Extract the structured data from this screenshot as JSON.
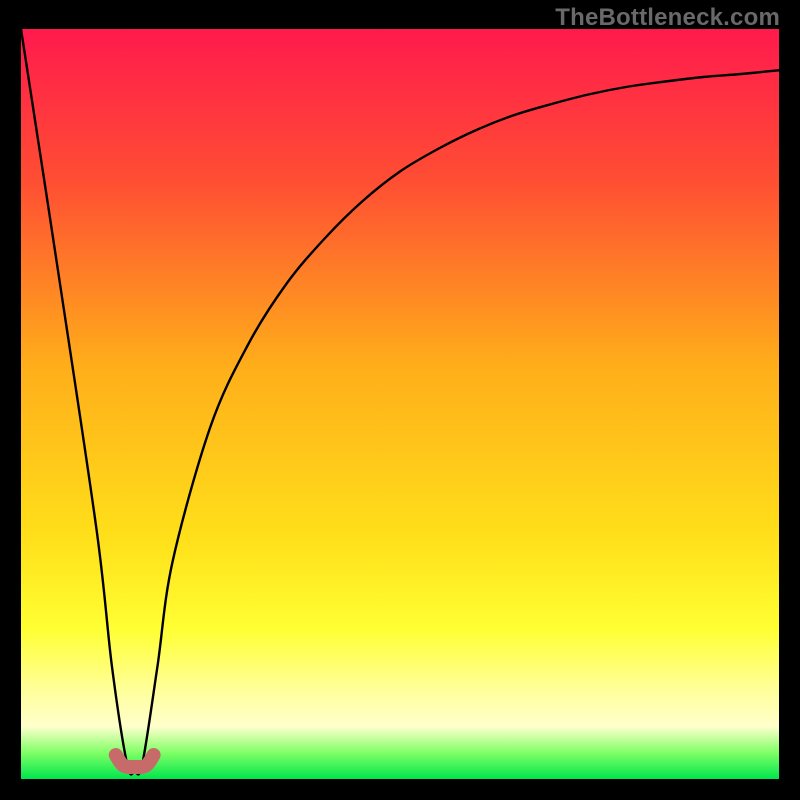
{
  "watermark": "TheBottleneck.com",
  "chart_data": {
    "type": "line",
    "title": "",
    "xlabel": "",
    "ylabel": "",
    "xlim": [
      0,
      100
    ],
    "ylim": [
      0,
      100
    ],
    "series": [
      {
        "name": "bottleneck-curve",
        "x": [
          0,
          5,
          10,
          12,
          14,
          15,
          16,
          18,
          20,
          25,
          30,
          35,
          40,
          45,
          50,
          55,
          60,
          65,
          70,
          75,
          80,
          85,
          90,
          95,
          100
        ],
        "y": [
          100,
          67,
          33,
          15,
          2,
          1,
          2,
          15,
          29,
          47,
          58,
          66,
          72,
          77,
          81,
          84,
          86.5,
          88.5,
          90,
          91.3,
          92.3,
          93,
          93.6,
          94,
          94.5
        ]
      },
      {
        "name": "sweet-spot-marker",
        "x": [
          12.5,
          13.5,
          15,
          16.5,
          17.5
        ],
        "y": [
          3.2,
          1.8,
          1.6,
          1.8,
          3.2
        ]
      }
    ],
    "gradient_stops": [
      {
        "pos": 0.0,
        "color": "#ff1a4d"
      },
      {
        "pos": 0.2,
        "color": "#ff4d33"
      },
      {
        "pos": 0.45,
        "color": "#ffae1a"
      },
      {
        "pos": 0.68,
        "color": "#ffe01a"
      },
      {
        "pos": 0.8,
        "color": "#ffff33"
      },
      {
        "pos": 0.88,
        "color": "#ffff99"
      },
      {
        "pos": 0.93,
        "color": "#ffffcc"
      },
      {
        "pos": 0.965,
        "color": "#80ff66"
      },
      {
        "pos": 1.0,
        "color": "#00e64d"
      }
    ],
    "marker_color": "#c76a6a",
    "curve_color": "#000000"
  }
}
